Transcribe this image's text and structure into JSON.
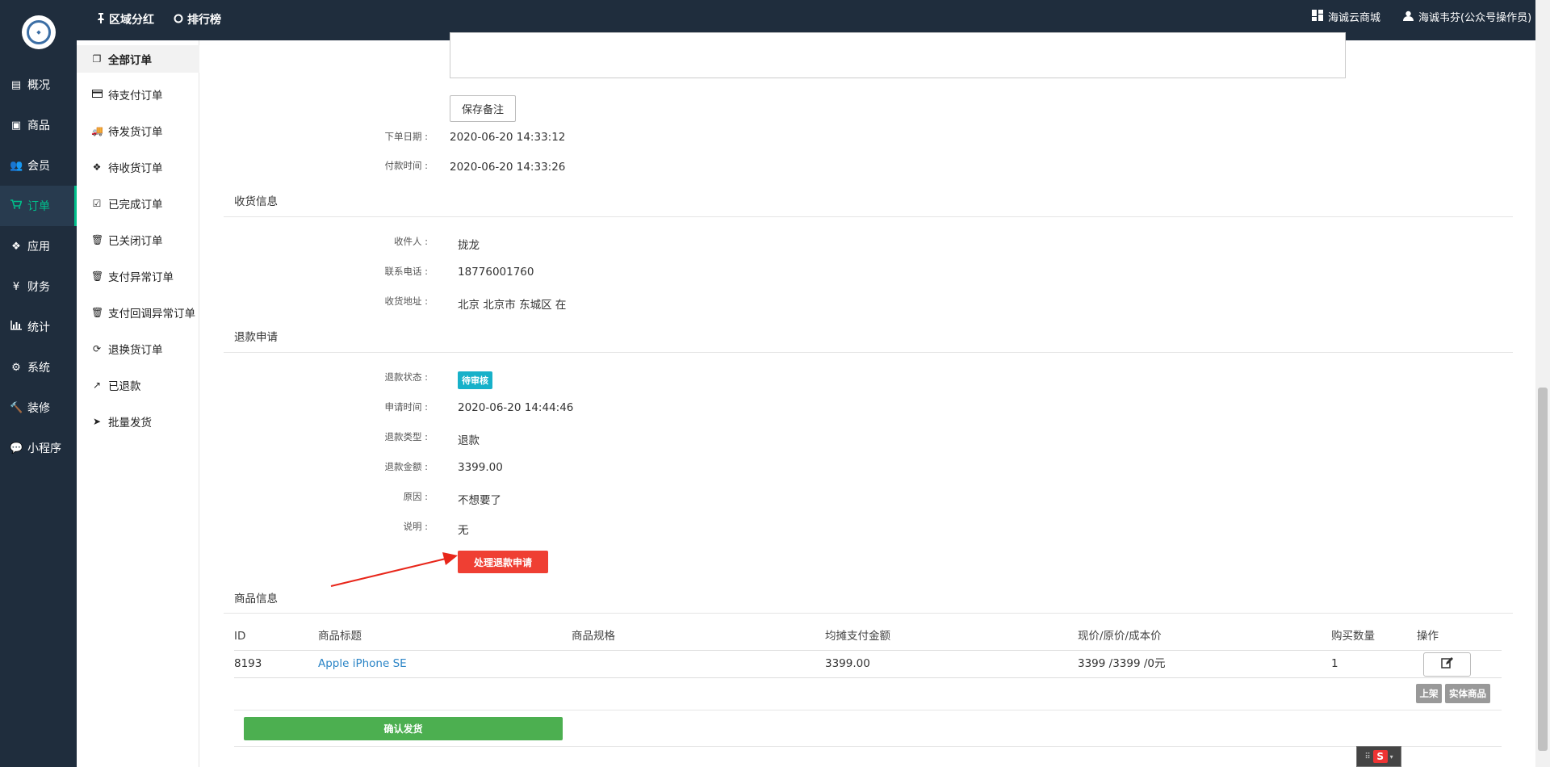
{
  "topbar": {
    "nav": [
      {
        "label": "区域分红",
        "icon": "pin-icon"
      },
      {
        "label": "排行榜",
        "icon": "circle-icon"
      }
    ],
    "shop_name": "海诚云商城",
    "user_name": "海诚韦芬(公众号操作员)"
  },
  "sidebar": {
    "items": [
      {
        "label": "概况",
        "icon": "inbox-icon"
      },
      {
        "label": "商品",
        "icon": "box-icon"
      },
      {
        "label": "会员",
        "icon": "users-icon"
      },
      {
        "label": "订单",
        "icon": "cart-icon"
      },
      {
        "label": "应用",
        "icon": "cubes-icon"
      },
      {
        "label": "财务",
        "icon": "yen-icon"
      },
      {
        "label": "统计",
        "icon": "bar-chart-icon"
      },
      {
        "label": "系统",
        "icon": "gears-icon"
      },
      {
        "label": "装修",
        "icon": "gavel-icon"
      },
      {
        "label": "小程序",
        "icon": "wechat-icon"
      }
    ],
    "active": "订单"
  },
  "submenu": {
    "items": [
      {
        "label": "全部订单",
        "icon": "copy-icon"
      },
      {
        "label": "待支付订单",
        "icon": "credit-card-icon"
      },
      {
        "label": "待发货订单",
        "icon": "truck-icon"
      },
      {
        "label": "待收货订单",
        "icon": "dropbox-icon"
      },
      {
        "label": "已完成订单",
        "icon": "check-square-icon"
      },
      {
        "label": "已关闭订单",
        "icon": "trash-icon"
      },
      {
        "label": "支付异常订单",
        "icon": "trash-icon"
      },
      {
        "label": "支付回调异常订单",
        "icon": "trash-icon"
      },
      {
        "label": "退换货订单",
        "icon": "refresh-icon"
      },
      {
        "label": "已退款",
        "icon": "share-icon"
      },
      {
        "label": "批量发货",
        "icon": "paper-plane-icon"
      }
    ]
  },
  "order": {
    "save_note_label": "保存备注",
    "order_date_label": "下单日期 :",
    "order_date": "2020-06-20 14:33:12",
    "pay_time_label": "付款时间 :",
    "pay_time": "2020-06-20 14:33:26"
  },
  "shipping": {
    "title": "收货信息",
    "receiver_label": "收件人 :",
    "receiver": "拢龙",
    "phone_label": "联系电话 :",
    "phone": "18776001760",
    "address_label": "收货地址 :",
    "address": "北京 北京市 东城区 在"
  },
  "refund": {
    "title": "退款申请",
    "status_label": "退款状态 :",
    "status": "待审核",
    "apply_time_label": "申请时间 :",
    "apply_time": "2020-06-20 14:44:46",
    "type_label": "退款类型 :",
    "type": "退款",
    "amount_label": "退款金额 :",
    "amount": "3399.00",
    "reason_label": "原因 :",
    "reason": "不想要了",
    "note_label": "说明 :",
    "note": "无",
    "process_button": "处理退款申请"
  },
  "goods": {
    "title": "商品信息",
    "columns": [
      "ID",
      "商品标题",
      "商品规格",
      "均摊支付金额",
      "现价/原价/成本价",
      "购买数量",
      "操作"
    ],
    "rows": [
      {
        "id": "8193",
        "title": "Apple iPhone SE",
        "spec": "",
        "paid": "3399.00",
        "price": "3399 /3399 /0元",
        "qty": "1"
      }
    ],
    "tag_on_shelf": "上架",
    "tag_physical": "实体商品",
    "confirm_ship": "确认发货"
  },
  "colors": {
    "sidebar_bg": "#1f2d3d",
    "accent": "#00c08b",
    "refund_button": "#ef3f33",
    "status_badge": "#17b1c9",
    "ship_button": "#4caf50",
    "link": "#2a84c6"
  }
}
